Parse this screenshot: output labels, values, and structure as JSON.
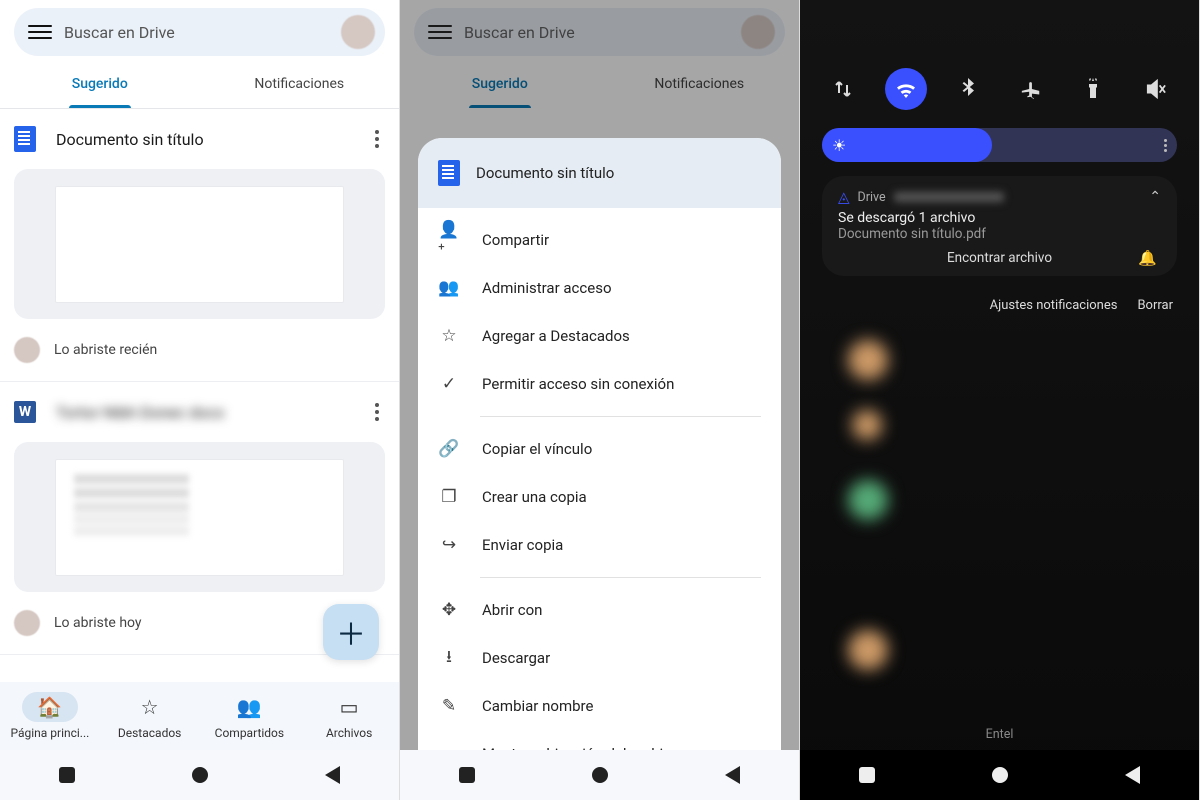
{
  "p1": {
    "search_placeholder": "Buscar en Drive",
    "tabs": {
      "suggested": "Sugerido",
      "notifications": "Notificaciones"
    },
    "files": [
      {
        "icon": "doc",
        "title": "Documento sin título",
        "meta": "Lo abriste recién",
        "blur": false,
        "lines": false
      },
      {
        "icon": "word",
        "title": "Tortor Nibh Donec docx",
        "meta": "Lo abriste hoy",
        "blur": true,
        "lines": true
      }
    ],
    "nav": [
      {
        "label": "Página princi...",
        "icon": "🏠",
        "active": true
      },
      {
        "label": "Destacados",
        "icon": "☆"
      },
      {
        "label": "Compartidos",
        "icon": "👥"
      },
      {
        "label": "Archivos",
        "icon": "▭"
      }
    ]
  },
  "p2": {
    "sheet_title": "Documento sin título",
    "items_g1": [
      {
        "icon": "person-plus",
        "label": "Compartir"
      },
      {
        "icon": "people",
        "label": "Administrar acceso"
      },
      {
        "icon": "star",
        "label": "Agregar a Destacados"
      },
      {
        "icon": "offline",
        "label": "Permitir acceso sin conexión"
      }
    ],
    "items_g2": [
      {
        "icon": "link",
        "label": "Copiar el vínculo"
      },
      {
        "icon": "copy",
        "label": "Crear una copia"
      },
      {
        "icon": "send",
        "label": "Enviar copia"
      }
    ],
    "items_g3": [
      {
        "icon": "open",
        "label": "Abrir con"
      },
      {
        "icon": "download",
        "label": "Descargar"
      },
      {
        "icon": "rename",
        "label": "Cambiar nombre"
      },
      {
        "icon": "folder",
        "label": "Mostrar ubicación del archivo"
      }
    ]
  },
  "p3": {
    "qs": [
      {
        "name": "data",
        "glyph": "⇅",
        "active": false
      },
      {
        "name": "wifi",
        "glyph": "ᯤ",
        "active": true
      },
      {
        "name": "bluetooth",
        "glyph": "✱",
        "active": false
      },
      {
        "name": "airplane",
        "glyph": "✈",
        "active": false
      },
      {
        "name": "flashlight",
        "glyph": "🔦",
        "active": false
      },
      {
        "name": "mute",
        "glyph": "🔇",
        "active": false
      }
    ],
    "notif_app": "Drive",
    "notif_title": "Se descargó 1 archivo",
    "notif_sub": "Documento sin título.pdf",
    "notif_action": "Encontrar archivo",
    "shade_settings": "Ajustes notificaciones",
    "shade_clear": "Borrar",
    "carrier": "Entel"
  },
  "icons": {
    "person-plus": "＋👤",
    "people": "👥",
    "star": "☆",
    "offline": "✓",
    "link": "🔗",
    "copy": "❐",
    "send": "↪",
    "open": "✥",
    "download": "⭳",
    "rename": "✎",
    "folder": "▭"
  }
}
